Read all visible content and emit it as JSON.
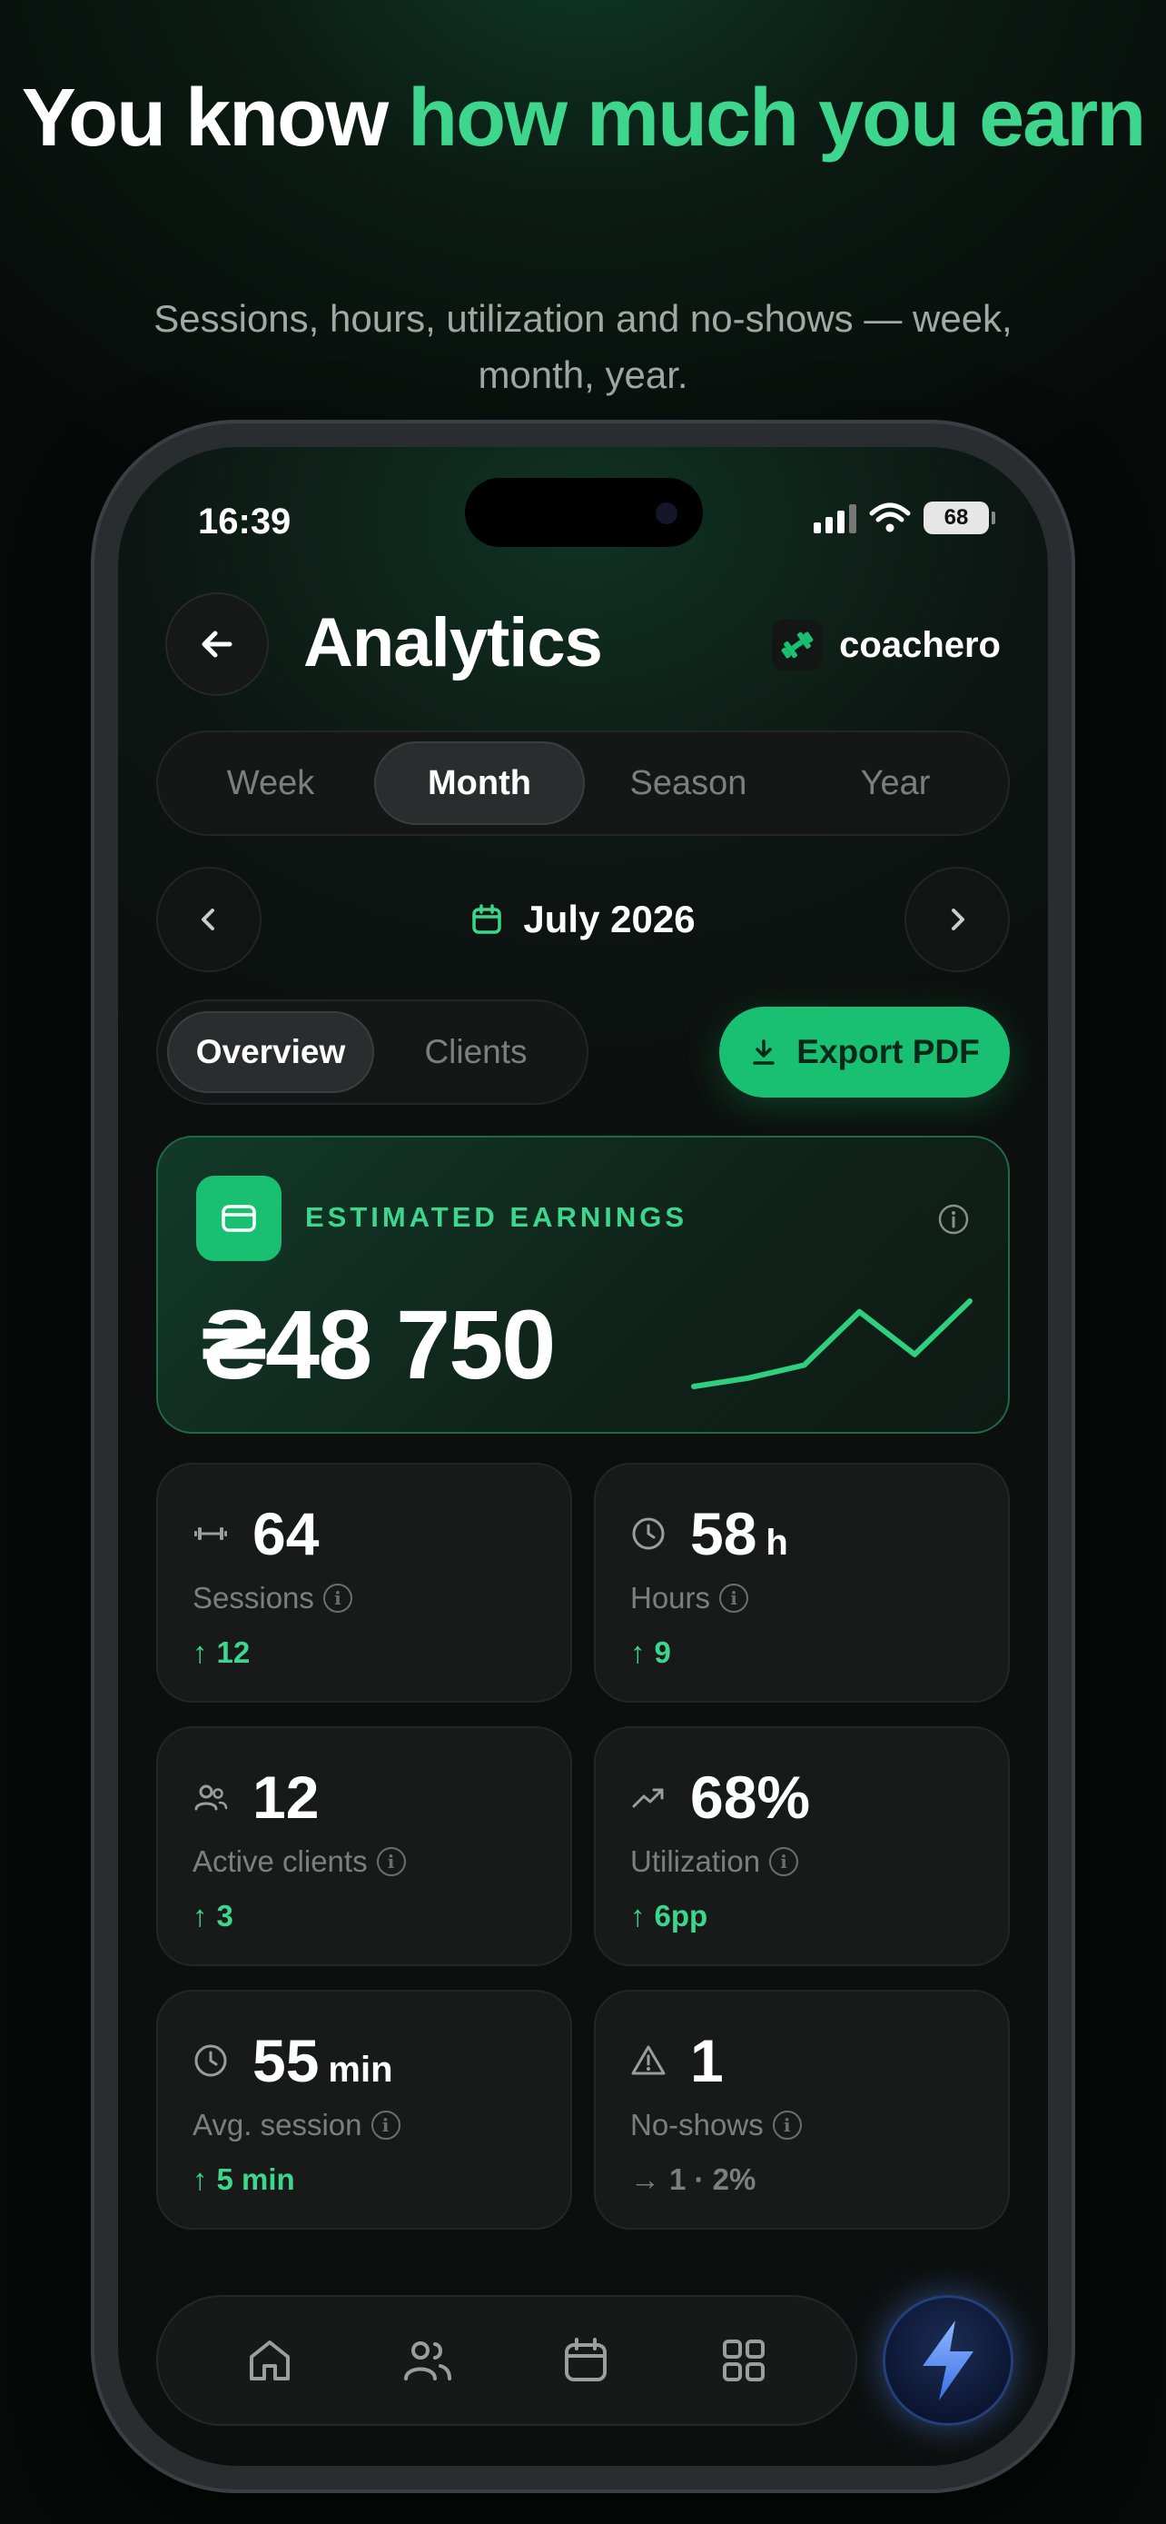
{
  "promo": {
    "headline_white": "You know ",
    "headline_green": "how much you earn",
    "subline": "Sessions, hours, utilization and no-shows — week, month, year."
  },
  "status_bar": {
    "time": "16:39",
    "battery": "68"
  },
  "header": {
    "title": "Analytics",
    "brand_name": "coachero"
  },
  "period_tabs": [
    {
      "label": "Week",
      "active": false
    },
    {
      "label": "Month",
      "active": true
    },
    {
      "label": "Season",
      "active": false
    },
    {
      "label": "Year",
      "active": false
    }
  ],
  "period": {
    "label": "July 2026"
  },
  "view_tabs": [
    {
      "label": "Overview",
      "active": true
    },
    {
      "label": "Clients",
      "active": false
    }
  ],
  "export_button": "Export PDF",
  "earnings": {
    "label": "ESTIMATED EARNINGS",
    "value": "₴48 750",
    "sparkline": [
      0,
      4,
      10,
      35,
      15,
      40
    ]
  },
  "stats": [
    {
      "icon": "dumbbell-icon",
      "value": "64",
      "unit": "",
      "label": "Sessions",
      "delta": "12",
      "trend": "up"
    },
    {
      "icon": "clock-icon",
      "value": "58",
      "unit": "h",
      "label": "Hours",
      "delta": "9",
      "trend": "up"
    },
    {
      "icon": "users-icon",
      "value": "12",
      "unit": "",
      "label": "Active clients",
      "delta": "3",
      "trend": "up"
    },
    {
      "icon": "trending-up-icon",
      "value": "68%",
      "unit": "",
      "label": "Utilization",
      "delta": "6pp",
      "trend": "up"
    },
    {
      "icon": "clock-icon",
      "value": "55",
      "unit": "min",
      "label": "Avg. session",
      "delta": "5 min",
      "trend": "up"
    },
    {
      "icon": "warning-icon",
      "value": "1",
      "unit": "",
      "label": "No-shows",
      "delta": "1 · 2%",
      "trend": "flat"
    }
  ],
  "tab_bar": [
    "home-icon",
    "clients-icon",
    "calendar-icon",
    "grid-icon"
  ],
  "colors": {
    "accent": "#3dd68c",
    "button": "#19c071",
    "background": "#0c0f0e",
    "fab_glow": "#5a8cff"
  }
}
